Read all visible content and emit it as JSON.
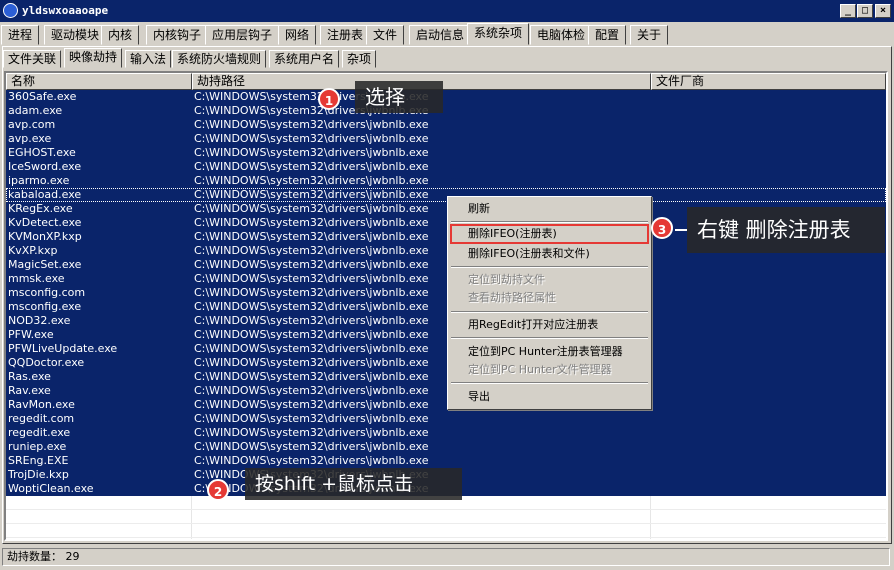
{
  "window": {
    "title": "yldswxoaaoape",
    "min_glyph": "_",
    "max_glyph": "□",
    "close_glyph": "×"
  },
  "main_tabs": [
    {
      "label": "进程"
    },
    {
      "label": "驱动模块"
    },
    {
      "label": "内核"
    },
    {
      "label": "内核钩子"
    },
    {
      "label": "应用层钩子"
    },
    {
      "label": "网络"
    },
    {
      "label": "注册表"
    },
    {
      "label": "文件"
    },
    {
      "label": "启动信息"
    },
    {
      "label": "系统杂项"
    },
    {
      "label": "电脑体检"
    },
    {
      "label": "配置"
    },
    {
      "label": "关于"
    }
  ],
  "main_active_tab": "系统杂项",
  "sub_tabs": [
    {
      "label": "文件关联"
    },
    {
      "label": "映像劫持"
    },
    {
      "label": "输入法"
    },
    {
      "label": "系统防火墙规则"
    },
    {
      "label": "系统用户名"
    },
    {
      "label": "杂项"
    }
  ],
  "sub_active_tab": "映像劫持",
  "columns": {
    "name": "名称",
    "path": "劫持路径",
    "vendor": "文件厂商"
  },
  "rows": [
    {
      "name": "360Safe.exe",
      "path": "C:\\WINDOWS\\system32\\drivers\\jwbnlb.exe",
      "vendor": ""
    },
    {
      "name": "adam.exe",
      "path": "C:\\WINDOWS\\system32\\drivers\\jwbnlb.exe",
      "vendor": ""
    },
    {
      "name": "avp.com",
      "path": "C:\\WINDOWS\\system32\\drivers\\jwbnlb.exe",
      "vendor": ""
    },
    {
      "name": "avp.exe",
      "path": "C:\\WINDOWS\\system32\\drivers\\jwbnlb.exe",
      "vendor": ""
    },
    {
      "name": "EGHOST.exe",
      "path": "C:\\WINDOWS\\system32\\drivers\\jwbnlb.exe",
      "vendor": ""
    },
    {
      "name": "IceSword.exe",
      "path": "C:\\WINDOWS\\system32\\drivers\\jwbnlb.exe",
      "vendor": ""
    },
    {
      "name": "iparmo.exe",
      "path": "C:\\WINDOWS\\system32\\drivers\\jwbnlb.exe",
      "vendor": ""
    },
    {
      "name": "kabaload.exe",
      "path": "C:\\WINDOWS\\system32\\drivers\\jwbnlb.exe",
      "vendor": ""
    },
    {
      "name": "KRegEx.exe",
      "path": "C:\\WINDOWS\\system32\\drivers\\jwbnlb.exe",
      "vendor": ""
    },
    {
      "name": "KvDetect.exe",
      "path": "C:\\WINDOWS\\system32\\drivers\\jwbnlb.exe",
      "vendor": ""
    },
    {
      "name": "KVMonXP.kxp",
      "path": "C:\\WINDOWS\\system32\\drivers\\jwbnlb.exe",
      "vendor": ""
    },
    {
      "name": "KvXP.kxp",
      "path": "C:\\WINDOWS\\system32\\drivers\\jwbnlb.exe",
      "vendor": ""
    },
    {
      "name": "MagicSet.exe",
      "path": "C:\\WINDOWS\\system32\\drivers\\jwbnlb.exe",
      "vendor": ""
    },
    {
      "name": "mmsk.exe",
      "path": "C:\\WINDOWS\\system32\\drivers\\jwbnlb.exe",
      "vendor": ""
    },
    {
      "name": "msconfig.com",
      "path": "C:\\WINDOWS\\system32\\drivers\\jwbnlb.exe",
      "vendor": ""
    },
    {
      "name": "msconfig.exe",
      "path": "C:\\WINDOWS\\system32\\drivers\\jwbnlb.exe",
      "vendor": ""
    },
    {
      "name": "NOD32.exe",
      "path": "C:\\WINDOWS\\system32\\drivers\\jwbnlb.exe",
      "vendor": ""
    },
    {
      "name": "PFW.exe",
      "path": "C:\\WINDOWS\\system32\\drivers\\jwbnlb.exe",
      "vendor": ""
    },
    {
      "name": "PFWLiveUpdate.exe",
      "path": "C:\\WINDOWS\\system32\\drivers\\jwbnlb.exe",
      "vendor": ""
    },
    {
      "name": "QQDoctor.exe",
      "path": "C:\\WINDOWS\\system32\\drivers\\jwbnlb.exe",
      "vendor": ""
    },
    {
      "name": "Ras.exe",
      "path": "C:\\WINDOWS\\system32\\drivers\\jwbnlb.exe",
      "vendor": ""
    },
    {
      "name": "Rav.exe",
      "path": "C:\\WINDOWS\\system32\\drivers\\jwbnlb.exe",
      "vendor": ""
    },
    {
      "name": "RavMon.exe",
      "path": "C:\\WINDOWS\\system32\\drivers\\jwbnlb.exe",
      "vendor": ""
    },
    {
      "name": "regedit.com",
      "path": "C:\\WINDOWS\\system32\\drivers\\jwbnlb.exe",
      "vendor": ""
    },
    {
      "name": "regedit.exe",
      "path": "C:\\WINDOWS\\system32\\drivers\\jwbnlb.exe",
      "vendor": ""
    },
    {
      "name": "runiep.exe",
      "path": "C:\\WINDOWS\\system32\\drivers\\jwbnlb.exe",
      "vendor": ""
    },
    {
      "name": "SREng.EXE",
      "path": "C:\\WINDOWS\\system32\\drivers\\jwbnlb.exe",
      "vendor": ""
    },
    {
      "name": "TrojDie.kxp",
      "path": "C:\\WINDOWS\\system32\\drivers\\jwbnlb.exe",
      "vendor": ""
    },
    {
      "name": "WoptiClean.exe",
      "path": "C:\\WINDOWS\\system32\\drivers\\jwbnlb.exe",
      "vendor": ""
    }
  ],
  "context_menu": {
    "refresh": "刷新",
    "delete_ifeo_reg": "删除IFEO(注册表)",
    "delete_ifeo_reg_file": "删除IFEO(注册表和文件)",
    "locate_file": "定位到劫持文件",
    "view_path_props": "查看劫持路径属性",
    "open_regedit": "用RegEdit打开对应注册表",
    "locate_reg_mgr": "定位到PC Hunter注册表管理器",
    "locate_file_mgr": "定位到PC Hunter文件管理器",
    "export": "导出"
  },
  "annotations": {
    "step1_num": "1",
    "step1_text": "选择",
    "step2_num": "2",
    "step2_text": "按shift +鼠标点击",
    "step3_num": "3",
    "step3_text": "右键 删除注册表",
    "accent_color": "#e53935"
  },
  "status": {
    "label": "劫持数量： 29"
  }
}
